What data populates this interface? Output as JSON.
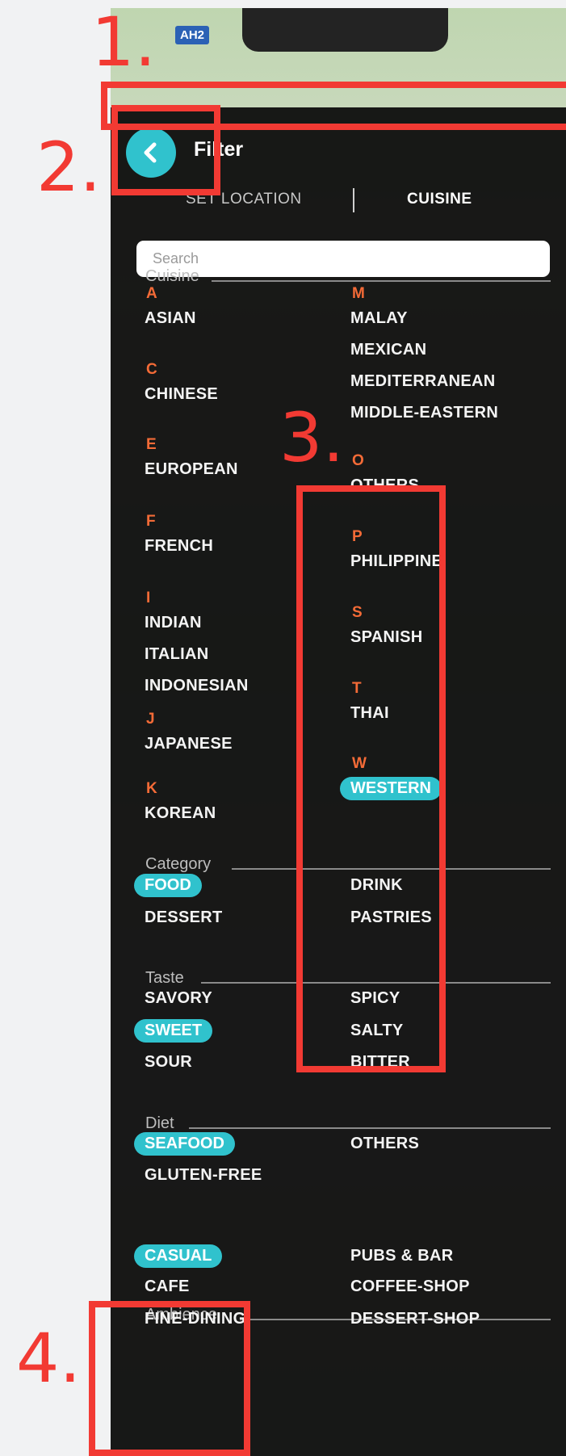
{
  "annotations": {
    "n1": "1.",
    "n2": "2.",
    "n3": "3.",
    "n4": "4."
  },
  "map": {
    "road_label": "AH2"
  },
  "header": {
    "title": "Filter",
    "back_icon": "chevron-left-icon"
  },
  "tabs": [
    {
      "label": "SET LOCATION",
      "active": false
    },
    {
      "label": "CUISINE",
      "active": true
    }
  ],
  "search": {
    "placeholder": "Search"
  },
  "cuisine": {
    "label": "Cuisine",
    "left": [
      {
        "letter": "A",
        "items": [
          "ASIAN"
        ]
      },
      {
        "letter": "C",
        "items": [
          "CHINESE"
        ]
      },
      {
        "letter": "E",
        "items": [
          "EUROPEAN"
        ]
      },
      {
        "letter": "F",
        "items": [
          "FRENCH"
        ]
      },
      {
        "letter": "I",
        "items": [
          "INDIAN",
          "ITALIAN",
          "INDONESIAN"
        ]
      },
      {
        "letter": "J",
        "items": [
          "JAPANESE"
        ]
      },
      {
        "letter": "K",
        "items": [
          "KOREAN"
        ]
      }
    ],
    "right": [
      {
        "letter": "M",
        "items": [
          "MALAY",
          "MEXICAN",
          "MEDITERRANEAN",
          "MIDDLE-EASTERN"
        ]
      },
      {
        "letter": "O",
        "items": [
          "OTHERS"
        ]
      },
      {
        "letter": "P",
        "items": [
          "PHILIPPINE"
        ]
      },
      {
        "letter": "S",
        "items": [
          "SPANISH"
        ]
      },
      {
        "letter": "T",
        "items": [
          "THAI"
        ]
      },
      {
        "letter": "W",
        "items": [
          "WESTERN"
        ]
      }
    ],
    "selected": "WESTERN"
  },
  "category": {
    "label": "Category",
    "left": [
      "FOOD",
      "DESSERT"
    ],
    "right": [
      "DRINK",
      "PASTRIES"
    ],
    "selected": "FOOD"
  },
  "taste": {
    "label": "Taste",
    "left": [
      "SAVORY",
      "SWEET",
      "SOUR"
    ],
    "right": [
      "SPICY",
      "SALTY",
      "BITTER"
    ],
    "selected": "SWEET"
  },
  "diet": {
    "label": "Diet",
    "left": [
      "SEAFOOD",
      "GLUTEN-FREE"
    ],
    "right": [
      "OTHERS"
    ],
    "selected": "SEAFOOD"
  },
  "ambience": {
    "label": "Ambience",
    "left": [
      "CASUAL",
      "CAFE",
      "FINE-DINING"
    ],
    "right": [
      "PUBS & BAR",
      "COFFEE-SHOP",
      "DESSERT-SHOP"
    ],
    "selected": "CASUAL"
  },
  "colors": {
    "accent": "#30c2cd",
    "letter": "#f46b37",
    "annotation": "#f23a33",
    "panel": "#080808"
  }
}
